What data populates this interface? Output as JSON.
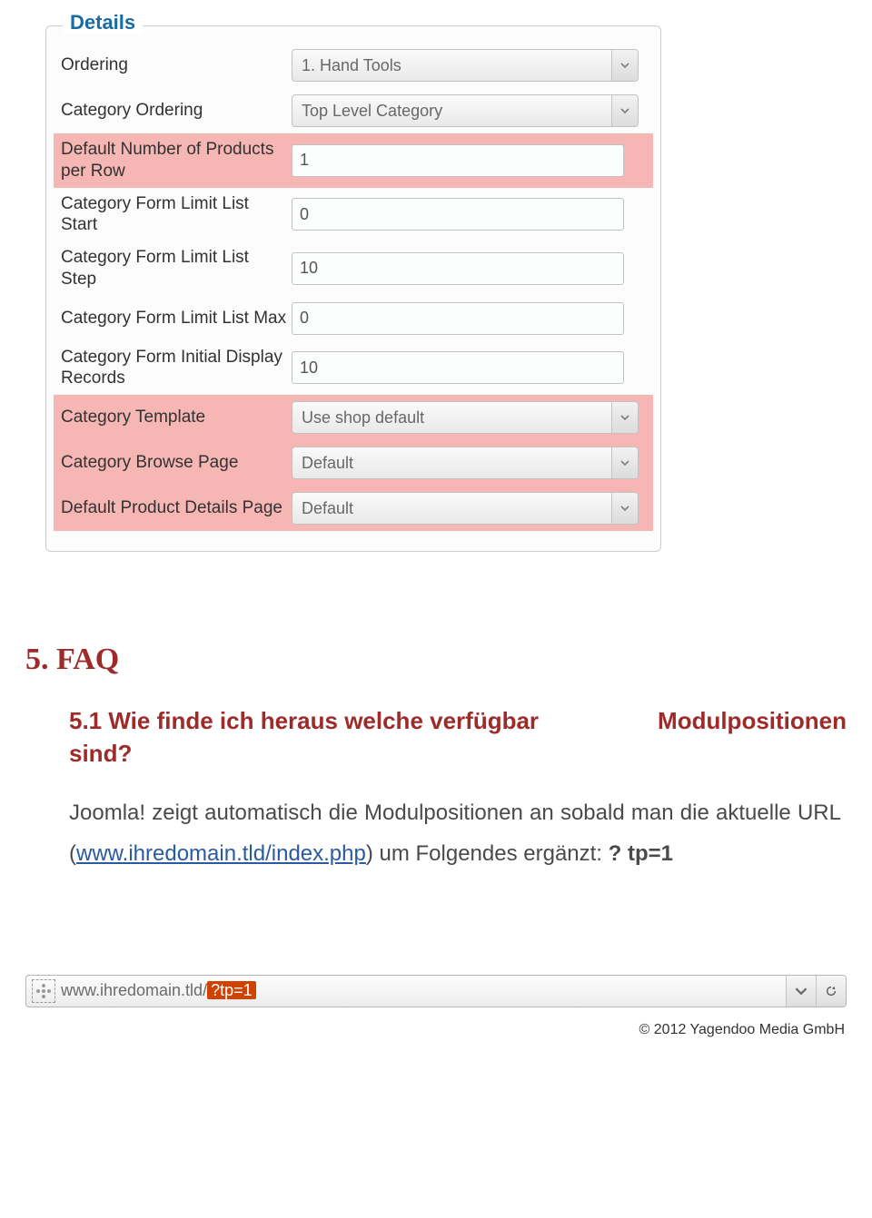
{
  "panel": {
    "legend": "Details",
    "rows": [
      {
        "label": "Ordering",
        "type": "select",
        "value": "1. Hand Tools",
        "highlight": false
      },
      {
        "label": "Category Ordering",
        "type": "select",
        "value": "Top Level Category",
        "highlight": false
      },
      {
        "label": "Default Number of Products per Row",
        "type": "text",
        "value": "1",
        "highlight": true
      },
      {
        "label": "Category Form Limit List Start",
        "type": "text",
        "value": "0",
        "highlight": false
      },
      {
        "label": "Category Form Limit List Step",
        "type": "text",
        "value": "10",
        "highlight": false
      },
      {
        "label": "Category Form Limit List Max",
        "type": "text",
        "value": "0",
        "highlight": false
      },
      {
        "label": "Category Form Initial Display Records",
        "type": "text",
        "value": "10",
        "highlight": false
      },
      {
        "label": "Category Template",
        "type": "select",
        "value": "Use shop default",
        "highlight": true
      },
      {
        "label": "Category Browse Page",
        "type": "select",
        "value": "Default",
        "highlight": true
      },
      {
        "label": "Default Product Details Page",
        "type": "select",
        "value": "Default",
        "highlight": true
      }
    ]
  },
  "doc": {
    "faq_heading": "5. FAQ",
    "sub_left": "5.1 Wie finde ich heraus welche verfügbar sind?",
    "sub_right": "Modulpositionen",
    "p1a": "Joomla! zeigt automatisch die Modulpositionen an sobald man die aktuelle URL (",
    "p1link": "www.ihredomain.tld/index.php",
    "p1b": ") um Folgendes ergänzt: ",
    "p1bold": "? tp=1"
  },
  "addr": {
    "host": "www.ihredomain.tld",
    "slash": "/",
    "query": "?tp=1"
  },
  "copyright": "© 2012 Yagendoo Media GmbH"
}
